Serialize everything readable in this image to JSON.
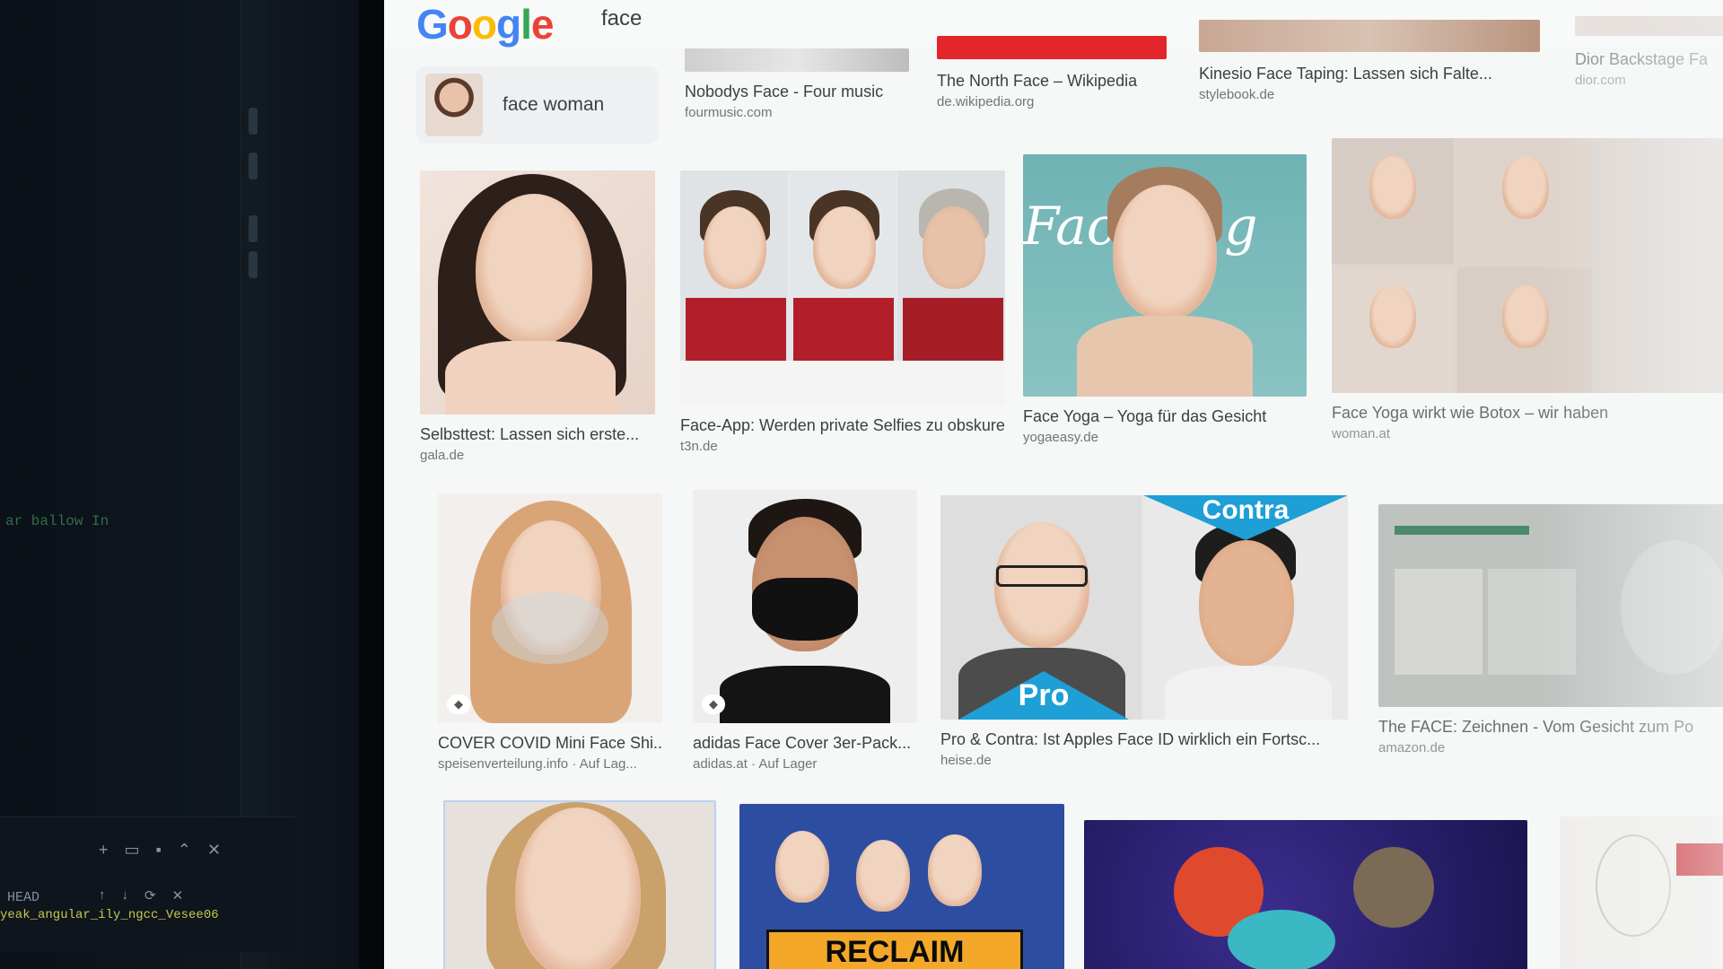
{
  "editor": {
    "code_line": "ar ballow In",
    "branch": "HEAD",
    "terminal_line": "yeak_angular_ily_ngcc_Vesee06"
  },
  "browser": {
    "logo": [
      "G",
      "o",
      "o",
      "g",
      "l",
      "e"
    ],
    "logo_colors": [
      "#4285F4",
      "#EA4335",
      "#FBBC05",
      "#4285F4",
      "#34A853",
      "#EA4335"
    ],
    "search": {
      "value": "face"
    },
    "related_chip": {
      "label": "face woman"
    }
  },
  "top_row": [
    {
      "caption": "Nobodys Face - Four music",
      "source": "fourmusic.com"
    },
    {
      "caption": "The North Face – Wikipedia",
      "source": "de.wikipedia.org"
    },
    {
      "caption": "Kinesio Face Taping: Lassen sich Falte...",
      "source": "stylebook.de"
    },
    {
      "caption": "Dior Backstage Fa",
      "source": "dior.com"
    }
  ],
  "row1": [
    {
      "caption": "Selbsttest: Lassen sich erste...",
      "source": "gala.de"
    },
    {
      "caption": "Face-App: Werden private Selfies zu obskuren Zw...",
      "source": "t3n.de"
    },
    {
      "caption": "Face Yoga – Yoga für das Gesicht",
      "source": "yogaeasy.de",
      "overlay": "Face Yog"
    },
    {
      "caption": "Face Yoga wirkt wie Botox – wir haben",
      "source": "woman.at"
    }
  ],
  "row2": [
    {
      "caption": "COVER COVID Mini Face Shi...",
      "source": "speisenverteilung.info · Auf Lag..."
    },
    {
      "caption": "adidas Face Cover 3er-Pack...",
      "source": "adidas.at · Auf Lager"
    },
    {
      "caption": "Pro & Contra: Ist Apples Face ID wirklich ein Fortsc...",
      "source": "heise.de",
      "badge_pro": "Pro",
      "badge_contra": "Contra"
    },
    {
      "caption": "The FACE: Zeichnen - Vom Gesicht zum Po",
      "source": "amazon.de"
    }
  ],
  "row3": [
    {
      "banner": "RECLAIM"
    }
  ]
}
